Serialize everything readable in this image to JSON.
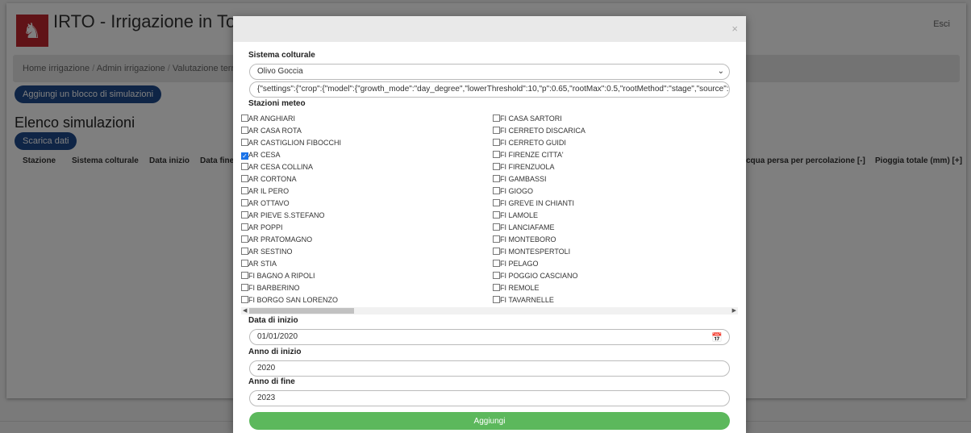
{
  "app": {
    "title": "IRTO - Irrigazione in Toscana",
    "logout": "Esci"
  },
  "breadcrumb": [
    "Home irrigazione",
    "Admin irrigazione",
    "Valutazione territoriale"
  ],
  "buttons": {
    "add_block": "Aggiungi un blocco di simulazioni",
    "download": "Scarica dati"
  },
  "page_heading": "Elenco simulazioni",
  "table": {
    "headers_left": [
      "Stazione",
      "Sistema colturale",
      "Data inizio",
      "Data fine"
    ],
    "headers_right": [
      "cqua persa per percolazione [-]",
      "Pioggia totale (mm) [+]"
    ]
  },
  "modal": {
    "crop_label": "Sistema colturale",
    "crop_value": "Olivo Goccia",
    "settings_value": "{\"settings\":{\"crop\":{\"model\":{\"growth_mode\":\"day_degree\",\"lowerThreshold\":10,\"p\":0.65,\"rootMax\":0.5,\"rootMethod\":\"stage\",\"source\":\"poderi\",\"stages\":[{\"r",
    "stations_label": "Stazioni meteo",
    "stations_left": [
      {
        "name": "AR ANGHIARI",
        "checked": false
      },
      {
        "name": "AR CASA ROTA",
        "checked": false
      },
      {
        "name": "AR CASTIGLION FIBOCCHI",
        "checked": false
      },
      {
        "name": "AR CESA",
        "checked": true
      },
      {
        "name": "AR CESA COLLINA",
        "checked": false
      },
      {
        "name": "AR CORTONA",
        "checked": false
      },
      {
        "name": "AR IL PERO",
        "checked": false
      },
      {
        "name": "AR OTTAVO",
        "checked": false
      },
      {
        "name": "AR PIEVE S.STEFANO",
        "checked": false
      },
      {
        "name": "AR POPPI",
        "checked": false
      },
      {
        "name": "AR PRATOMAGNO",
        "checked": false
      },
      {
        "name": "AR SESTINO",
        "checked": false
      },
      {
        "name": "AR STIA",
        "checked": false
      },
      {
        "name": "FI BAGNO A RIPOLI",
        "checked": false
      },
      {
        "name": "FI BARBERINO",
        "checked": false
      },
      {
        "name": "FI BORGO SAN LORENZO",
        "checked": false
      }
    ],
    "stations_right": [
      {
        "name": "FI CASA SARTORI",
        "checked": false
      },
      {
        "name": "FI CERRETO DISCARICA",
        "checked": false
      },
      {
        "name": "FI CERRETO GUIDI",
        "checked": false
      },
      {
        "name": "FI FIRENZE CITTA'",
        "checked": false
      },
      {
        "name": "FI FIRENZUOLA",
        "checked": false
      },
      {
        "name": "FI GAMBASSI",
        "checked": false
      },
      {
        "name": "FI GIOGO",
        "checked": false
      },
      {
        "name": "FI GREVE IN CHIANTI",
        "checked": false
      },
      {
        "name": "FI LAMOLE",
        "checked": false
      },
      {
        "name": "FI LANCIAFAME",
        "checked": false
      },
      {
        "name": "FI MONTEBORO",
        "checked": false
      },
      {
        "name": "FI MONTESPERTOLI",
        "checked": false
      },
      {
        "name": "FI PELAGO",
        "checked": false
      },
      {
        "name": "FI POGGIO CASCIANO",
        "checked": false
      },
      {
        "name": "FI REMOLE",
        "checked": false
      },
      {
        "name": "FI TAVARNELLE",
        "checked": false
      }
    ],
    "start_date_label": "Data di inizio",
    "start_date_value": "01/01/2020",
    "start_year_label": "Anno di inizio",
    "start_year_value": "2020",
    "end_year_label": "Anno di fine",
    "end_year_value": "2023",
    "submit_label": "Aggiungi",
    "close_glyph": "×"
  },
  "icons": {
    "logo": "tuscany-pegasus-logo",
    "close": "close-icon",
    "select": "chevron-down-icon",
    "calendar": "calendar-icon"
  },
  "colors": {
    "primary": "#1f4a8c",
    "success": "#5cb85c",
    "checkbox": "#1a73e8",
    "logo_red": "#c0262e"
  }
}
